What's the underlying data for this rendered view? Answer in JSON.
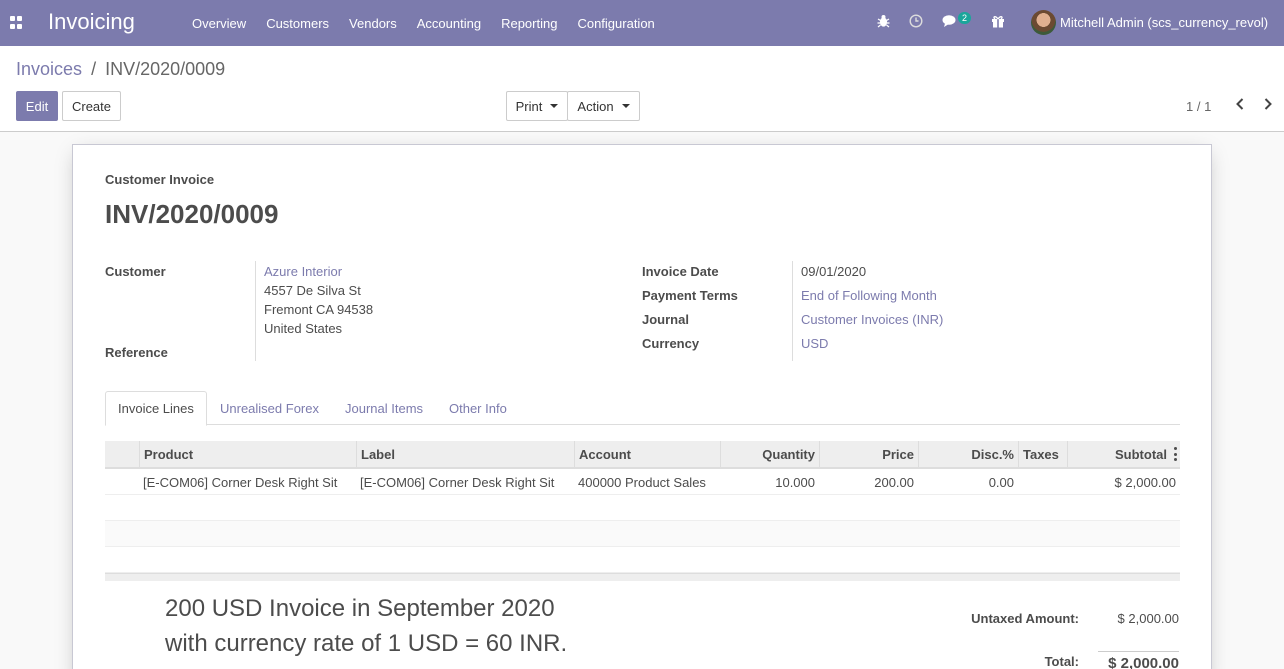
{
  "navbar": {
    "app_name": "Invoicing",
    "menu": [
      "Overview",
      "Customers",
      "Vendors",
      "Accounting",
      "Reporting",
      "Configuration"
    ],
    "messages_count": "2",
    "user_name": "Mitchell Admin (scs_currency_revol)",
    "accent_color": "#7c7bad"
  },
  "breadcrumb": {
    "parent": "Invoices",
    "separator": "/",
    "current": "INV/2020/0009"
  },
  "buttons": {
    "edit": "Edit",
    "create": "Create",
    "print": "Print",
    "action": "Action"
  },
  "pager": {
    "value": "1 / 1"
  },
  "form": {
    "kind": "Customer Invoice",
    "number": "INV/2020/0009",
    "customer_label": "Customer",
    "customer_name": "Azure Interior",
    "address_line1": "4557 De Silva St",
    "address_line2": "Fremont CA 94538",
    "address_line3": "United States",
    "reference_label": "Reference",
    "invoice_date_label": "Invoice Date",
    "invoice_date": "09/01/2020",
    "payment_terms_label": "Payment Terms",
    "payment_terms": "End of Following Month",
    "journal_label": "Journal",
    "journal": "Customer Invoices (INR)",
    "currency_label": "Currency",
    "currency": "USD"
  },
  "tabs": [
    "Invoice Lines",
    "Unrealised Forex",
    "Journal Items",
    "Other Info"
  ],
  "lines_table": {
    "columns": [
      "Product",
      "Label",
      "Account",
      "Quantity",
      "Price",
      "Disc.%",
      "Taxes",
      "Subtotal"
    ],
    "rows": [
      {
        "product": "[E-COM06] Corner Desk Right Sit",
        "label": "[E-COM06] Corner Desk Right Sit",
        "account": "400000 Product Sales",
        "quantity": "10.000",
        "price": "200.00",
        "discount": "0.00",
        "taxes": "",
        "subtotal": "$ 2,000.00"
      }
    ]
  },
  "note": {
    "line1": "200 USD Invoice in September 2020",
    "line2": "with currency rate of 1 USD = 60 INR."
  },
  "totals": {
    "untaxed_label": "Untaxed Amount:",
    "untaxed_value": "$ 2,000.00",
    "total_label": "Total:",
    "total_value": "$ 2,000.00"
  }
}
